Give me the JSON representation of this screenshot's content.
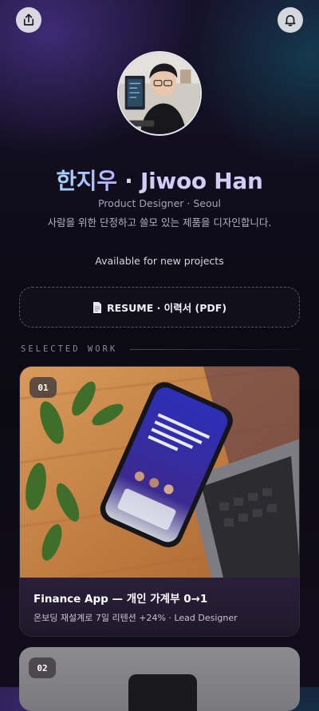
{
  "header": {
    "share_icon": "share-icon",
    "notifications_icon": "bell-icon"
  },
  "profile": {
    "name_ko": "한지우",
    "separator": " · ",
    "name_en": "Jiwoo Han",
    "role": "Product Designer · Seoul",
    "tagline": "사람을 위한 단정하고 쓸모 있는 제품을 디자인합니다.",
    "availability": "Available for new projects"
  },
  "resume": {
    "label": "RESUME · 이력서 (PDF)",
    "icon": "document-icon"
  },
  "work": {
    "section_title": "SELECTED WORK",
    "items": [
      {
        "index": "01",
        "title": "Finance App — 개인 가계부 0→1",
        "meta": "온보딩 재설계로 7일 리텐션 +24% · Lead Designer"
      },
      {
        "index": "02"
      }
    ]
  },
  "colors": {
    "name_gradient_start": "#9fd4ff",
    "name_gradient_end": "#b9b2ff",
    "background": "#0b0a12"
  }
}
